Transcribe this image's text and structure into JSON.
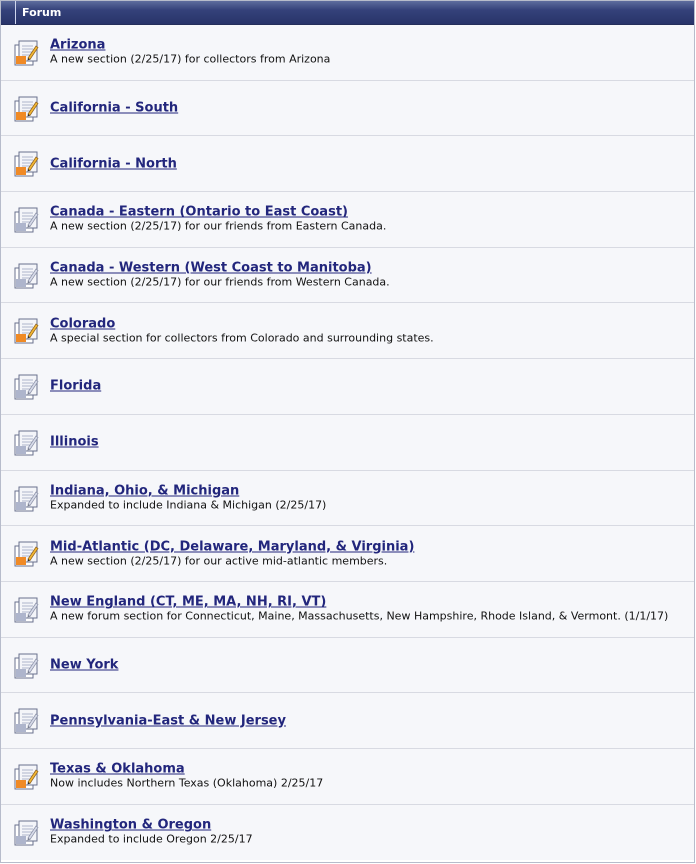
{
  "header": {
    "title": "Forum"
  },
  "colors": {
    "link": "#22267c",
    "header_bg": "#283469",
    "row_bg": "#f6f7fa",
    "row_border": "#d8dae2"
  },
  "forums": [
    {
      "title": "Arizona",
      "description": "A new section (2/25/17) for collectors from Arizona",
      "icon": "forum-new-posts-icon"
    },
    {
      "title": "California - South",
      "description": "",
      "icon": "forum-new-posts-icon"
    },
    {
      "title": "California - North",
      "description": "",
      "icon": "forum-new-posts-icon"
    },
    {
      "title": "Canada - Eastern (Ontario to East Coast)",
      "description": "A new section (2/25/17) for our friends from Eastern Canada.",
      "icon": "forum-no-new-posts-icon"
    },
    {
      "title": "Canada - Western (West Coast to Manitoba)",
      "description": "A new section (2/25/17) for our friends from Western Canada.",
      "icon": "forum-no-new-posts-icon"
    },
    {
      "title": "Colorado",
      "description": "A special section for collectors from Colorado and surrounding states.",
      "icon": "forum-new-posts-icon"
    },
    {
      "title": "Florida",
      "description": "",
      "icon": "forum-no-new-posts-icon"
    },
    {
      "title": "Illinois",
      "description": "",
      "icon": "forum-no-new-posts-icon"
    },
    {
      "title": "Indiana, Ohio, & Michigan",
      "description": "Expanded to include Indiana & Michigan (2/25/17)",
      "icon": "forum-no-new-posts-icon"
    },
    {
      "title": "Mid-Atlantic (DC, Delaware, Maryland, & Virginia)",
      "description": "A new section (2/25/17) for our active mid-atlantic members.",
      "icon": "forum-new-posts-icon"
    },
    {
      "title": "New England (CT, ME, MA, NH, RI, VT)",
      "description": "A new forum section for Connecticut, Maine, Massachusetts, New Hampshire, Rhode Island, & Vermont. (1/1/17)",
      "icon": "forum-no-new-posts-icon"
    },
    {
      "title": "New York",
      "description": "",
      "icon": "forum-no-new-posts-icon"
    },
    {
      "title": "Pennsylvania-East & New Jersey",
      "description": "",
      "icon": "forum-no-new-posts-icon"
    },
    {
      "title": "Texas & Oklahoma",
      "description": "Now includes Northern Texas (Oklahoma) 2/25/17",
      "icon": "forum-new-posts-icon"
    },
    {
      "title": "Washington & Oregon",
      "description": "Expanded to include Oregon 2/25/17",
      "icon": "forum-no-new-posts-icon"
    }
  ]
}
